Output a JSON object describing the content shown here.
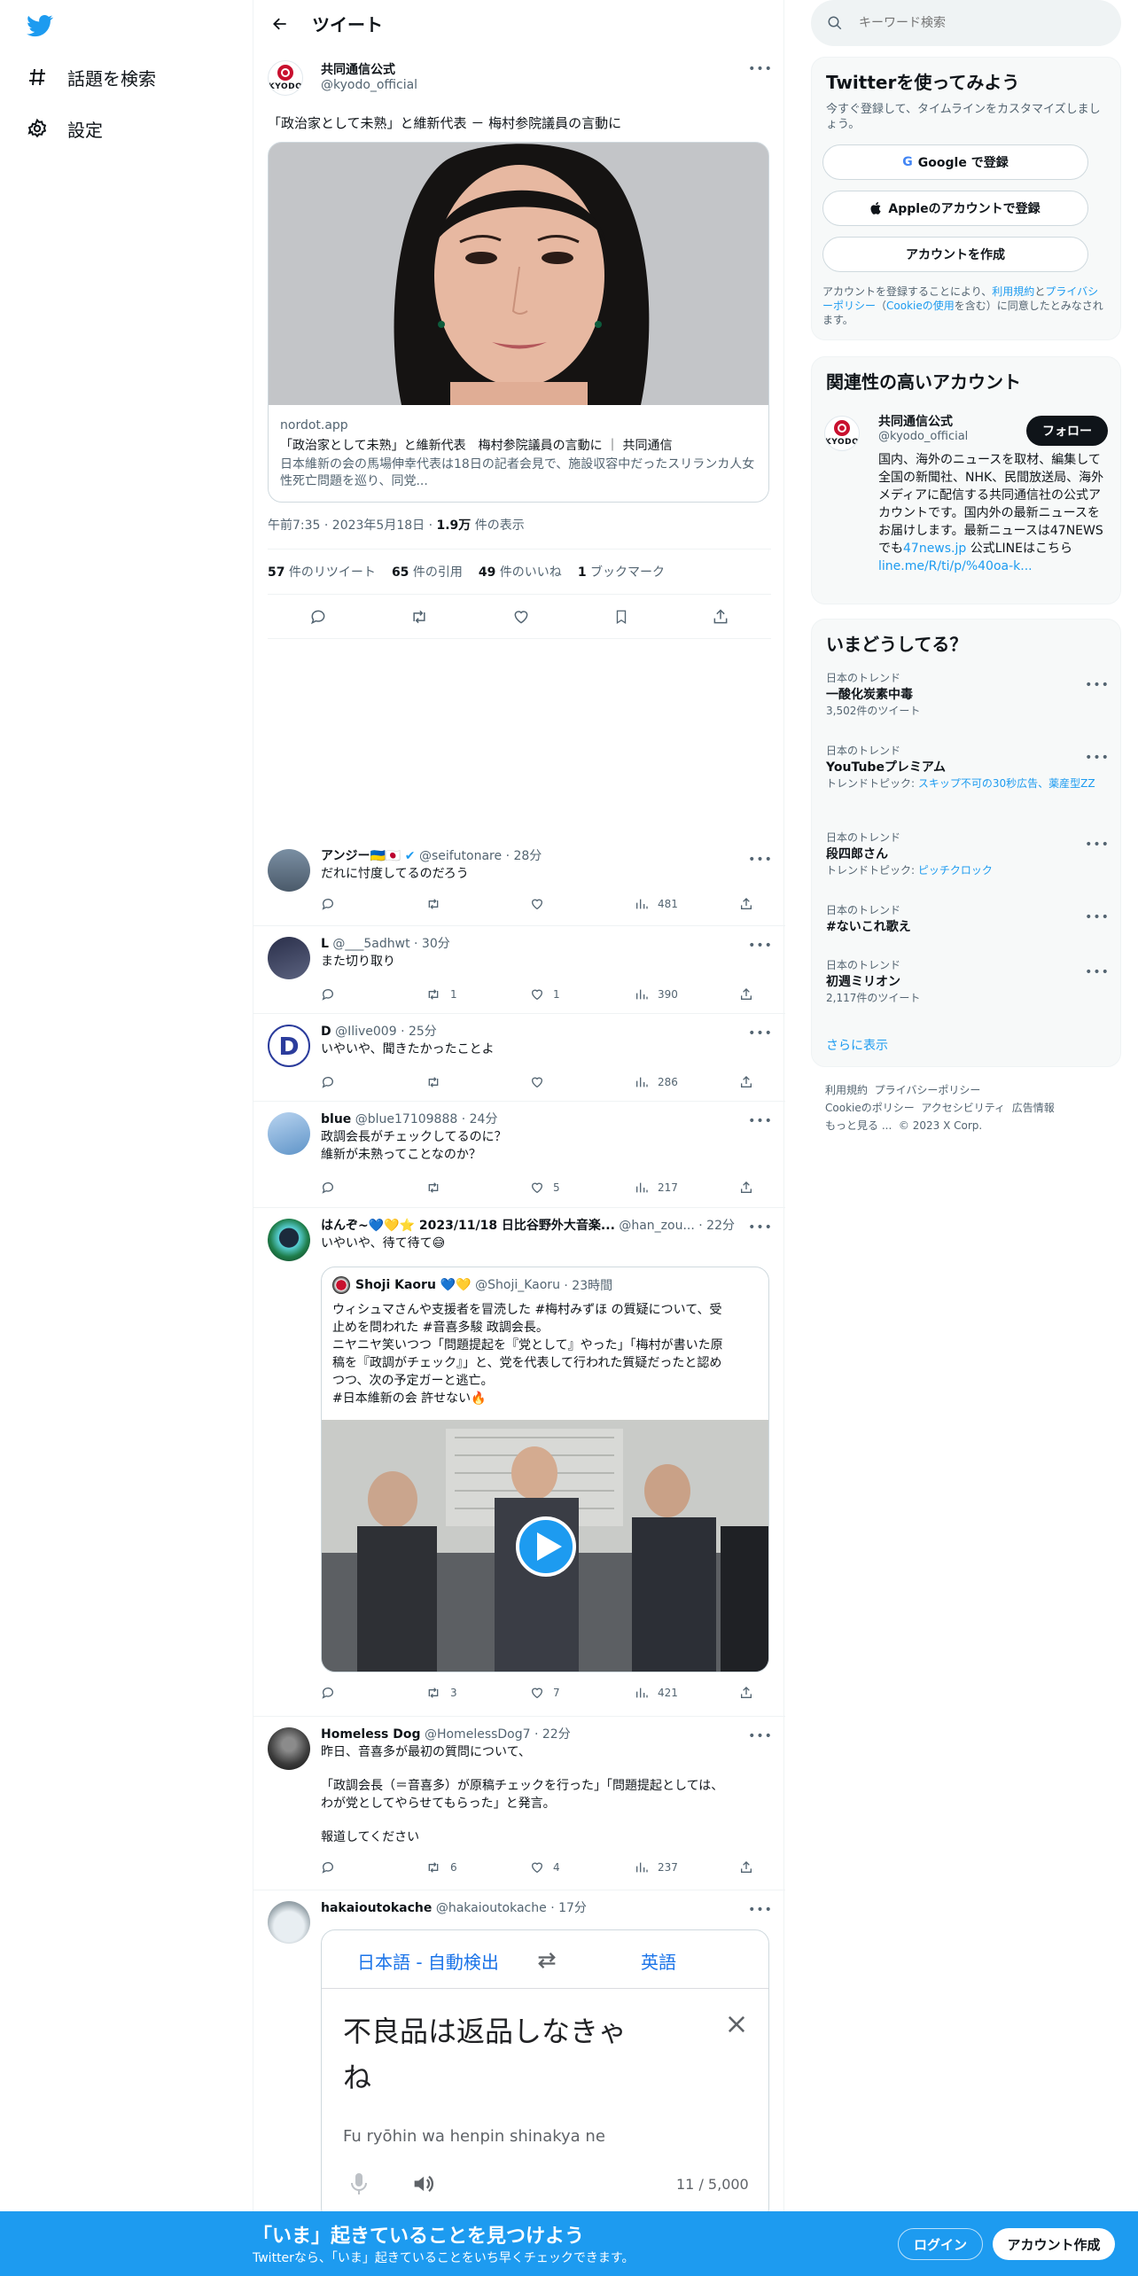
{
  "nav": {
    "explore": "話題を検索",
    "settings": "設定"
  },
  "header": {
    "title": "ツイート"
  },
  "main_tweet": {
    "name": "共同通信公式",
    "handle": "@kyodo_official",
    "avatar_text": "KYODO",
    "text": "「政治家として未熟」と維新代表 － 梅村参院議員の言動に",
    "card": {
      "domain": "nordot.app",
      "title": "「政治家として未熟」と維新代表　梅村参院議員の言動に ｜ 共同通信",
      "desc": "日本維新の会の馬場伸幸代表は18日の記者会見で、施設収容中だったスリランカ人女性死亡問題を巡り、同党..."
    },
    "time": "午前7:35 · 2023年5月18日 · ",
    "views": "1.9万",
    "views_label": " 件の表示",
    "stats": {
      "retweets": "57",
      "retweets_label": " 件のリツイート",
      "quotes": "65",
      "quotes_label": " 件の引用",
      "likes": "49",
      "likes_label": " 件のいいね",
      "bookmarks": "1",
      "bookmarks_label": " ブックマーク"
    }
  },
  "replies": [
    {
      "name": "アンジー🇺🇦🇯🇵",
      "handle": "@seifutonare",
      "time": "· 28分",
      "text": "だれに忖度してるのだろう",
      "rt": "",
      "like": "",
      "views": "481"
    },
    {
      "name": "L",
      "handle": "@___5adhwt",
      "time": "· 30分",
      "text": "また切り取り",
      "rt": "1",
      "like": "1",
      "views": "390"
    },
    {
      "name": "D",
      "handle": "@Ilive009",
      "time": "· 25分",
      "text": "いやいや、聞きたかったことよ",
      "rt": "",
      "like": "",
      "views": "286",
      "avatar_letter": "D"
    },
    {
      "name": "blue",
      "handle": "@blue17109888",
      "time": "· 24分",
      "text1": "政調会長がチェックしてるのに？",
      "text2": "維新が未熟ってことなのか？",
      "rt": "",
      "like": "5",
      "views": "217"
    },
    {
      "name": "はんぞ~💙💛⭐ 2023/11/18 日比谷野外大音楽...",
      "handle": "@han_zou...",
      "time": "· 22分",
      "text": "いやいや、待て待て😅",
      "rt": "3",
      "like": "7",
      "views": "421",
      "quote": {
        "name": "Shoji Kaoru 💙💛",
        "handle": "@Shoji_Kaoru",
        "time": "· 23時間",
        "lines": [
          "ウィシュマさんや支援者を冒涜した #梅村みずほ の質疑について、受",
          "止めを問われた #音喜多駿 政調会長。",
          "ニヤニヤ笑いつつ「問題提起を『党として』やった」「梅村が書いた原",
          "稿を『政調がチェック』」と、党を代表して行われた質疑だったと認め",
          "つつ、次の予定ガーと逃亡。",
          "#日本維新の会 許せない🔥"
        ]
      }
    },
    {
      "name": "Homeless Dog",
      "handle": "@HomelessDog7",
      "time": "· 22分",
      "text1": "昨日、音喜多が最初の質問について、",
      "text2": "「政調会長（＝音喜多）が原稿チェックを行った」「問題提起としては、",
      "text3": "わが党としてやらせてもらった」と発言。",
      "text4": "報道してください",
      "rt": "6",
      "like": "4",
      "views": "237"
    },
    {
      "name": "hakaioutokache",
      "handle": "@hakaioutokache",
      "time": "· 17分",
      "translate": {
        "src": "日本語 - 自動検出",
        "dst": "英語",
        "line1": "不良品は返品しなきゃ",
        "line2": "ね",
        "roman": "Fu ryōhin wa henpin shinakya ne",
        "count": "11 / 5,000"
      }
    }
  ],
  "right": {
    "search_placeholder": "キーワード検索",
    "signup": {
      "title": "Twitterを使ってみよう",
      "sub": "今すぐ登録して、タイムラインをカスタマイズしましょう。",
      "google": "Google で登録",
      "apple": "Appleのアカウントで登録",
      "create": "アカウントを作成",
      "terms_pre": "アカウントを登録することにより、",
      "terms_link": "利用規約",
      "terms_and": "と",
      "privacy_link": "プライバシーポリシー",
      "terms_mid": "（",
      "cookie_link": "Cookieの使用",
      "terms_post": "を含む）に同意したとみなされます。"
    },
    "related": {
      "title": "関連性の高いアカウント",
      "name": "共同通信公式",
      "handle": "@kyodo_official",
      "follow": "フォロー",
      "bio": "国内、海外のニュースを取材、編集して全国の新聞社、NHK、民間放送局、海外メディアに配信する共同通信社の公式アカウントです。国内外の最新ニュースをお届けします。最新ニュースは47NEWSでも",
      "bio_link1": "47news.jp",
      "bio_mid": " 公式LINEはこちら",
      "bio_link2": "line.me/R/ti/p/%40oa-k..."
    },
    "trends": {
      "title": "いまどうしてる？",
      "items": [
        {
          "cat": "日本のトレンド",
          "name": "一酸化炭素中毒",
          "meta": "3,502件のツイート"
        },
        {
          "cat": "日本のトレンド",
          "name": "YouTubeプレミアム",
          "meta_pre": "トレンドトピック: ",
          "meta_link": "スキップ不可の30秒広告、薬産型ZZ"
        },
        {
          "cat": "日本のトレンド",
          "name": "段四郎さん",
          "meta_pre": "トレンドトピック: ",
          "meta_link": "ピッチクロック"
        },
        {
          "cat": "日本のトレンド",
          "name": "#ないこれ歌え",
          "meta": ""
        },
        {
          "cat": "日本のトレンド",
          "name": "初週ミリオン",
          "meta": "2,117件のツイート"
        }
      ],
      "more": "さらに表示"
    },
    "footer": {
      "l1a": "利用規約",
      "l1b": "プライバシーポリシー",
      "l2a": "Cookieのポリシー",
      "l2b": "アクセシビリティ",
      "l2c": "広告情報",
      "l3a": "もっと見る ...",
      "l3b": "© 2023 X Corp."
    }
  },
  "bottom": {
    "title": "「いま」起きていることを見つけよう",
    "sub": "Twitterなら、「いま」起きていることをいち早くチェックできます。",
    "login": "ログイン",
    "signup": "アカウント作成"
  },
  "colors": {
    "accent": "#1d9bf0",
    "text": "#0f1419",
    "muted": "#536471"
  }
}
